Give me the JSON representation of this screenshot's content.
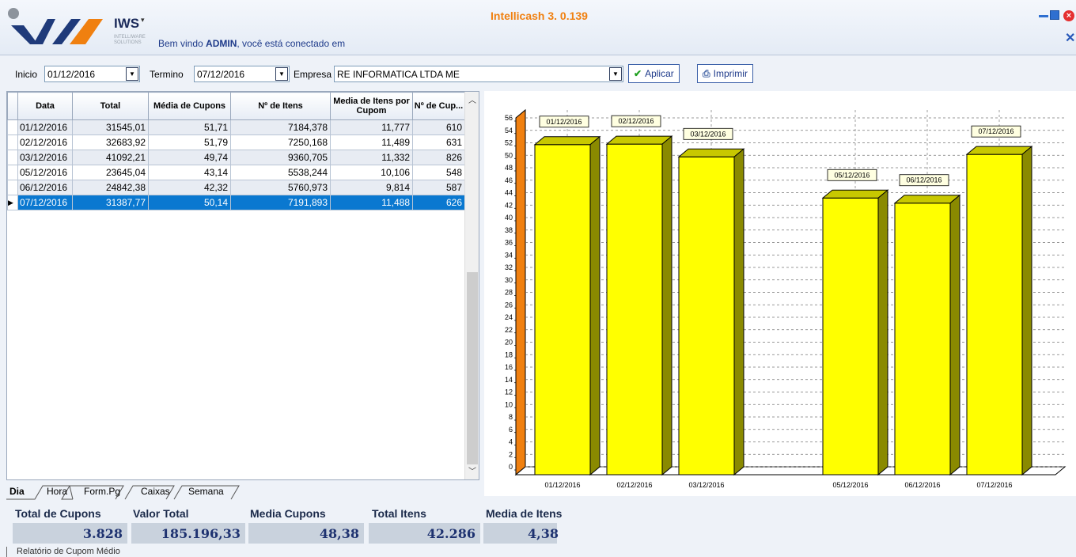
{
  "header": {
    "app_title": "Intellicash 3. 0.139",
    "logo_text": "IWS",
    "logo_sub": "INTELLIWARE SOLUTIONS",
    "welcome_prefix": "Bem vindo",
    "welcome_user": "ADMIN",
    "welcome_suffix": ", você está conectado em"
  },
  "toolbar": {
    "inicio_label": "Inicio",
    "inicio_value": "01/12/2016",
    "termino_label": "Termino",
    "termino_value": "07/12/2016",
    "empresa_label": "Empresa",
    "empresa_value": "RE INFORMATICA LTDA ME",
    "aplicar_label": "Aplicar",
    "imprimir_label": "Imprimir"
  },
  "grid": {
    "columns": [
      "Data",
      "Total",
      "Média de Cupons",
      "Nº de Itens",
      "Media de Itens por Cupom",
      "Nº de Cup..."
    ],
    "rows": [
      [
        "01/12/2016",
        "31545,01",
        "51,71",
        "7184,378",
        "11,777",
        "610"
      ],
      [
        "02/12/2016",
        "32683,92",
        "51,79",
        "7250,168",
        "11,489",
        "631"
      ],
      [
        "03/12/2016",
        "41092,21",
        "49,74",
        "9360,705",
        "11,332",
        "826"
      ],
      [
        "05/12/2016",
        "23645,04",
        "43,14",
        "5538,244",
        "10,106",
        "548"
      ],
      [
        "06/12/2016",
        "24842,38",
        "42,32",
        "5760,973",
        "9,814",
        "587"
      ],
      [
        "07/12/2016",
        "31387,77",
        "50,14",
        "7191,893",
        "11,488",
        "626"
      ]
    ],
    "selected_row": 5
  },
  "tabs": [
    "Dia",
    "Hora",
    "Form.Pg",
    "Caixas",
    "Semana"
  ],
  "summary": {
    "total_cupons_label": "Total de Cupons",
    "total_cupons_value": "3.828",
    "valor_total_label": "Valor Total",
    "valor_total_value": "185.196,33",
    "media_cupons_label": "Media Cupons",
    "media_cupons_value": "48,38",
    "total_itens_label": "Total Itens",
    "total_itens_value": "42.286",
    "media_itens_label": "Media de Itens",
    "media_itens_value": "4,38"
  },
  "bottom_tab": "Relatório de Cupom Médio",
  "chart_data": {
    "type": "bar",
    "categories": [
      "01/12/2016",
      "02/12/2016",
      "03/12/2016",
      "05/12/2016",
      "06/12/2016",
      "07/12/2016"
    ],
    "values": [
      51.71,
      51.79,
      49.74,
      43.14,
      42.32,
      50.14
    ],
    "ylim": [
      0,
      56
    ],
    "yticks": [
      0,
      2,
      4,
      6,
      8,
      10,
      12,
      14,
      16,
      18,
      20,
      22,
      24,
      26,
      28,
      30,
      32,
      34,
      36,
      38,
      40,
      42,
      44,
      46,
      48,
      50,
      52,
      54,
      56
    ],
    "grid": true,
    "bar_color": "#ffff00",
    "bar_side_color": "#8a8a00",
    "bar_top_color": "#c8c800"
  },
  "colors": {
    "accent": "#f08010",
    "selection": "#0a78d0"
  }
}
